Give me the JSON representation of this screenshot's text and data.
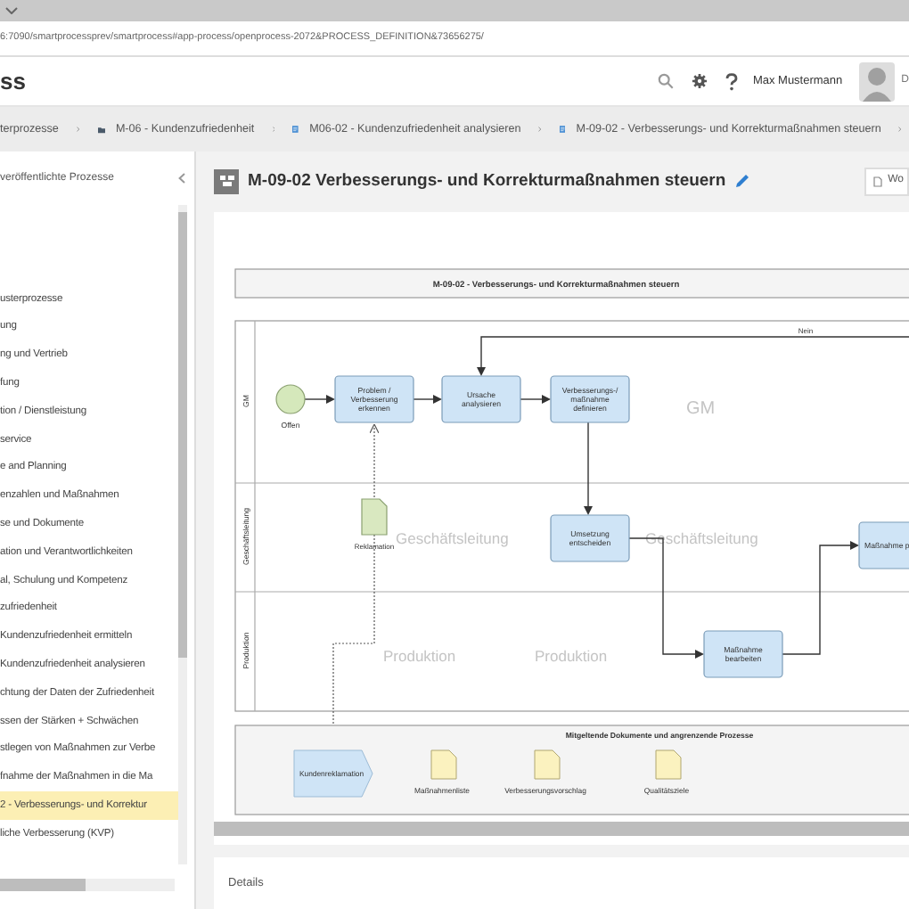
{
  "browser": {
    "url": "6:7090/smartprocessprev/smartprocess#app-process/openprocess-2072&PROCESS_DEFINITION&73656275/"
  },
  "header": {
    "title": "ss",
    "user_name": "Max Mustermann",
    "trailing_text": "D"
  },
  "breadcrumb": [
    {
      "kind": "plain",
      "label": "terprozesse"
    },
    {
      "kind": "folder",
      "label": "M-06 - Kundenzufriedenheit"
    },
    {
      "kind": "document",
      "label": "M06-02 - Kundenzufriedenheit analysieren"
    },
    {
      "kind": "document",
      "label": "M-09-02 - Verbesserungs- und Korrekturmaßnahmen steuern"
    }
  ],
  "sidebar": {
    "title": "veröffentlichte Prozesse",
    "items": [
      {
        "label": "usterprozesse",
        "selected": false
      },
      {
        "label": "ung",
        "selected": false
      },
      {
        "label": "ng und Vertrieb",
        "selected": false
      },
      {
        "label": "fung",
        "selected": false
      },
      {
        "label": "tion / Dienstleistung",
        "selected": false
      },
      {
        "label": "service",
        "selected": false
      },
      {
        "label": "e and Planning",
        "selected": false
      },
      {
        "label": "enzahlen und Maßnahmen",
        "selected": false
      },
      {
        "label": "se und Dokumente",
        "selected": false
      },
      {
        "label": "ation und Verantwortlichkeiten",
        "selected": false
      },
      {
        "label": "al, Schulung und Kompetenz",
        "selected": false
      },
      {
        "label": "zufriedenheit",
        "selected": false
      },
      {
        "label": "Kundenzufriedenheit ermitteln",
        "selected": false
      },
      {
        "label": "Kundenzufriedenheit analysieren",
        "selected": false
      },
      {
        "label": "chtung der Daten der Zufriedenheit",
        "selected": false
      },
      {
        "label": "ssen der Stärken + Schwächen",
        "selected": false
      },
      {
        "label": "stlegen von Maßnahmen zur Verbe",
        "selected": false
      },
      {
        "label": "fnahme der Maßnahmen in die Ma",
        "selected": false
      },
      {
        "label": "2 - Verbesserungs- und Korrektur",
        "selected": true
      },
      {
        "label": "liche Verbesserung (KVP)",
        "selected": false
      }
    ]
  },
  "process": {
    "title": "M-09-02 Verbesserungs- und Korrekturmaßnahmen steuern",
    "action_button": "Wo"
  },
  "diagram": {
    "header": "M-09-02 - Verbesserungs- und Korrekturmaßnahmen steuern",
    "lanes": [
      {
        "label": "GM",
        "watermarks": [
          "GM"
        ]
      },
      {
        "label": "Geschäftsleitung",
        "watermarks": [
          "Geschäftsleitung",
          "Geschäftsleitung"
        ]
      },
      {
        "label": "Produktion",
        "watermarks": [
          "Produktion",
          "Produktion"
        ]
      }
    ],
    "start_event": {
      "label": "Offen"
    },
    "tasks": [
      {
        "lines": [
          "Problem /",
          "Verbesserung",
          "erkennen"
        ]
      },
      {
        "lines": [
          "Ursache",
          "analysieren"
        ]
      },
      {
        "lines": [
          "Verbesserungs-/",
          "maßnahme",
          "definieren"
        ]
      },
      {
        "lines": [
          "Umsetzung",
          "entscheiden"
        ]
      },
      {
        "lines": [
          "Maßnahme",
          "bearbeiten"
        ]
      },
      {
        "lines": [
          "Maßnahme p"
        ]
      }
    ],
    "input_document": {
      "label": "Reklamation"
    },
    "condition_label": "Nein",
    "related": {
      "title": "Mitgeltende Dokumente und angrenzende Prozesse",
      "items": [
        {
          "kind": "process",
          "label": "Kundenreklamation"
        },
        {
          "kind": "document",
          "label": "Maßnahmenliste"
        },
        {
          "kind": "document",
          "label": "Verbesserungsvorschlag"
        },
        {
          "kind": "document",
          "label": "Qualitätsziele"
        }
      ]
    }
  },
  "details": {
    "title": "Details"
  }
}
